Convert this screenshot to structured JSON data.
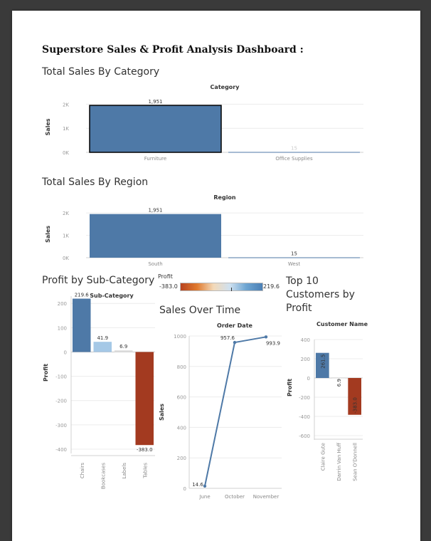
{
  "dashboard": {
    "title": "Superstore Sales & Profit Analysis Dashboard :"
  },
  "sheets": {
    "category": {
      "title": "Total Sales By Category"
    },
    "region": {
      "title": "Total Sales By Region"
    },
    "subcategory": {
      "title": "Profit by Sub-Category"
    },
    "time": {
      "title": "Sales Over Time"
    },
    "customers": {
      "title": "Top 10 Customers by Profit"
    }
  },
  "profit_legend": {
    "label": "Profit",
    "min_label": "-383.0",
    "max_label": "219.6",
    "colors": [
      "#b7431f",
      "#e07a2e",
      "#f3d9b8",
      "#cfe1f0",
      "#6ea5d2",
      "#4a7fb5"
    ]
  },
  "colors": {
    "bar_blue": "#4e79a7",
    "light_blue": "#a5c8e6",
    "neg_red": "#a33a20",
    "near_zero": "#dedede",
    "grid": "#ececec",
    "axis_text": "#999999"
  },
  "chart_data": [
    {
      "id": "category",
      "type": "bar",
      "header": "Category",
      "categories": [
        "Furniture",
        "Office Supplies"
      ],
      "values": [
        1951,
        15
      ],
      "value_labels": [
        "1,951",
        "15"
      ],
      "ylabel": "Sales",
      "yticks": [
        "0K",
        "1K",
        "2K"
      ],
      "ylim": [
        0,
        2100
      ],
      "selected": "Furniture"
    },
    {
      "id": "region",
      "type": "bar",
      "header": "Region",
      "categories": [
        "South",
        "West"
      ],
      "values": [
        1951,
        15
      ],
      "value_labels": [
        "1,951",
        "15"
      ],
      "ylabel": "Sales",
      "yticks": [
        "0K",
        "1K",
        "2K"
      ],
      "ylim": [
        0,
        2100
      ]
    },
    {
      "id": "subcategory",
      "type": "bar",
      "header": "Sub-Category",
      "categories": [
        "Chairs",
        "Bookcases",
        "Labels",
        "Tables"
      ],
      "values": [
        219.6,
        41.9,
        6.9,
        -383.0
      ],
      "value_labels": [
        "219.6",
        "41.9",
        "6.9",
        "-383.0"
      ],
      "ylabel": "Profit",
      "yticks": [
        "200",
        "100",
        "0",
        "-100",
        "-200",
        "-300",
        "-400"
      ],
      "ylim": [
        -400,
        230
      ]
    },
    {
      "id": "time",
      "type": "line",
      "header": "Order Date",
      "x": [
        "June",
        "October",
        "November"
      ],
      "values": [
        14.6,
        957.6,
        993.9
      ],
      "value_labels": [
        "14.6",
        "957.6",
        "993.9"
      ],
      "ylabel": "Sales",
      "yticks": [
        "0",
        "200",
        "400",
        "600",
        "800",
        "1000"
      ],
      "ylim": [
        0,
        1000
      ]
    },
    {
      "id": "customers",
      "type": "bar",
      "header": "Customer Name",
      "categories": [
        "Claire Gute",
        "Darrin Van Huff",
        "Sean O'Donnell"
      ],
      "values": [
        261.5,
        6.9,
        -383.0
      ],
      "value_labels": [
        "261.5",
        "6.9",
        "-383.0"
      ],
      "ylabel": "Profit",
      "yticks": [
        "400",
        "200",
        "0",
        "-200",
        "-400",
        "-600"
      ],
      "ylim": [
        -600,
        400
      ]
    }
  ]
}
